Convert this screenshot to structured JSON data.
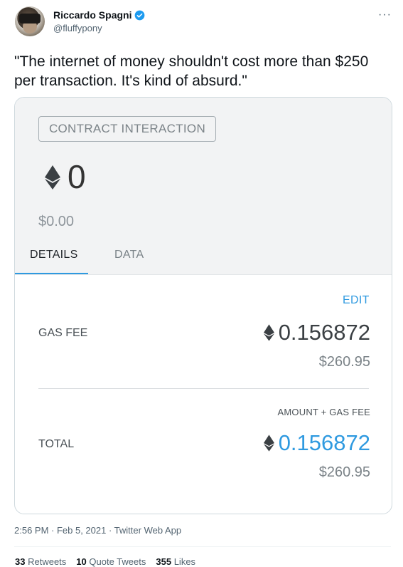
{
  "header": {
    "display_name": "Riccardo Spagni",
    "handle": "@fluffypony",
    "more": "···"
  },
  "tweet": {
    "text": "\"The internet of money shouldn't cost more than $250 per transaction. It's kind of absurd.\"",
    "timestamp": "2:56 PM · Feb 5, 2021 · Twitter Web App"
  },
  "card": {
    "badge": "CONTRACT INTERACTION",
    "amount": "0",
    "amount_usd": "$0.00",
    "tabs": [
      {
        "label": "DETAILS"
      },
      {
        "label": "DATA"
      }
    ],
    "edit": "EDIT",
    "gas_fee_label": "GAS FEE",
    "gas_fee_eth": "0.156872",
    "gas_fee_usd": "$260.95",
    "amount_gas_label": "AMOUNT + GAS FEE",
    "total_label": "TOTAL",
    "total_eth": "0.156872",
    "total_usd": "$260.95"
  },
  "stats": {
    "retweets_count": "33",
    "retweets_label": "Retweets",
    "quotes_count": "10",
    "quotes_label": "Quote Tweets",
    "likes_count": "355",
    "likes_label": "Likes"
  },
  "colors": {
    "accent": "#2f9ae0",
    "verified": "#1d9bf0"
  }
}
